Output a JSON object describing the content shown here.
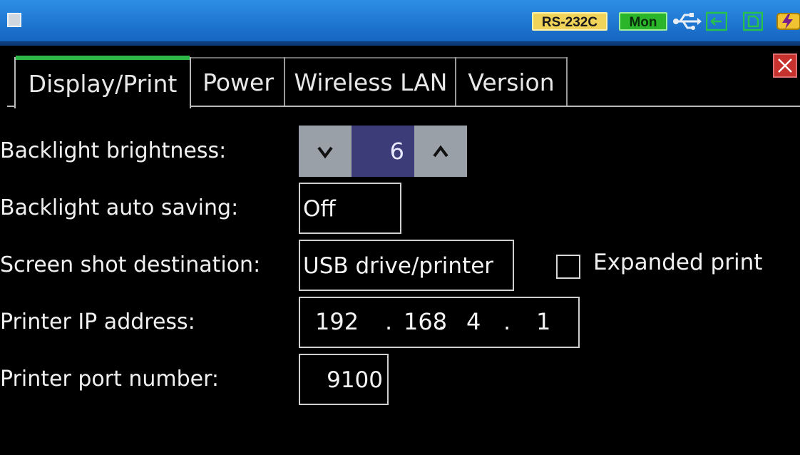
{
  "status_bar": {
    "menu_icon": "menu-square-icon",
    "rs232c_badge": "RS-232C",
    "mon_badge": "Mon",
    "icons": [
      "usb-icon",
      "lan-connection-icon",
      "sd-card-icon",
      "power-icon"
    ]
  },
  "tabs": [
    {
      "label": "Display/Print",
      "active": true
    },
    {
      "label": "Power",
      "active": false
    },
    {
      "label": "Wireless LAN",
      "active": false
    },
    {
      "label": "Version",
      "active": false
    }
  ],
  "close_icon": "close-icon",
  "settings": {
    "backlight_brightness": {
      "label": "Backlight brightness:",
      "value": "6"
    },
    "backlight_auto_saving": {
      "label": "Backlight auto saving:",
      "value": "Off"
    },
    "screenshot_destination": {
      "label": "Screen shot destination:",
      "value": "USB drive/printer"
    },
    "expanded_print": {
      "label": "Expanded print",
      "checked": false
    },
    "printer_ip": {
      "label": "Printer IP address:",
      "octets": [
        "192",
        "168",
        "4",
        "1"
      ]
    },
    "printer_port": {
      "label": "Printer port number:",
      "value": "9100"
    }
  },
  "colors": {
    "status_bar": "#1e78d2",
    "tab_accent": "#2fb84a",
    "stepper_value_bg": "#3c3d78",
    "close_button": "#c8322e",
    "rs232c_badge": "#f0d45a",
    "mon_badge": "#2bb52b"
  }
}
